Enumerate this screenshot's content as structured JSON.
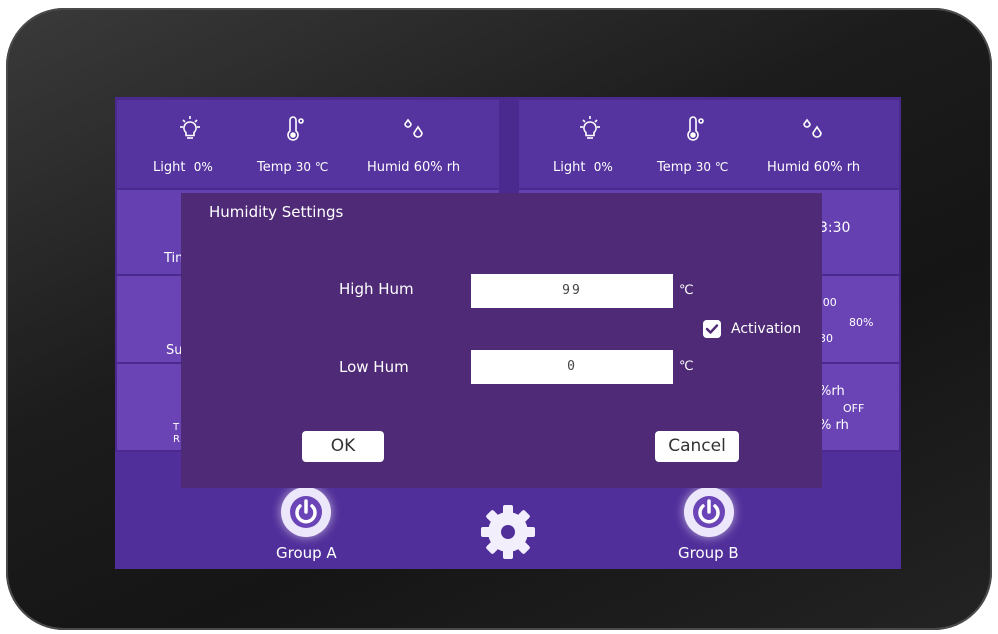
{
  "colors": {
    "screen": "#4a2a8e",
    "panel": "#5a35a8",
    "dialog": "#4f2a77",
    "text": "#ffffff"
  },
  "panels": [
    {
      "light_label": "Light",
      "light_value": "0%",
      "temp_label": "Temp",
      "temp_value": "30 ℃",
      "humid_label": "Humid",
      "humid_value": "60% rh"
    },
    {
      "light_label": "Light",
      "light_value": "0%",
      "temp_label": "Temp",
      "temp_value": "30 ℃",
      "humid_label": "Humid",
      "humid_value": "60% rh"
    }
  ],
  "left_fragments": {
    "timer": "Tim",
    "sun": "Su",
    "t": "T",
    "r": "R"
  },
  "right_fragments": {
    "time": "3:30",
    "t1": ":00",
    "pct": "80%",
    "t2": "30",
    "rh": "%rh",
    "off": "OFF",
    "rh2": "% rh"
  },
  "bottom": {
    "group_a": "Group A",
    "group_b": "Group B",
    "power_icon": "power-icon",
    "gear_icon": "gear-icon"
  },
  "dialog": {
    "title": "Humidity Settings",
    "high_label": "High Hum",
    "high_value": "99",
    "high_unit": "℃",
    "low_label": "Low Hum",
    "low_value": "0",
    "low_unit": "℃",
    "activation_label": "Activation",
    "activation_checked": true,
    "ok_label": "OK",
    "cancel_label": "Cancel"
  }
}
